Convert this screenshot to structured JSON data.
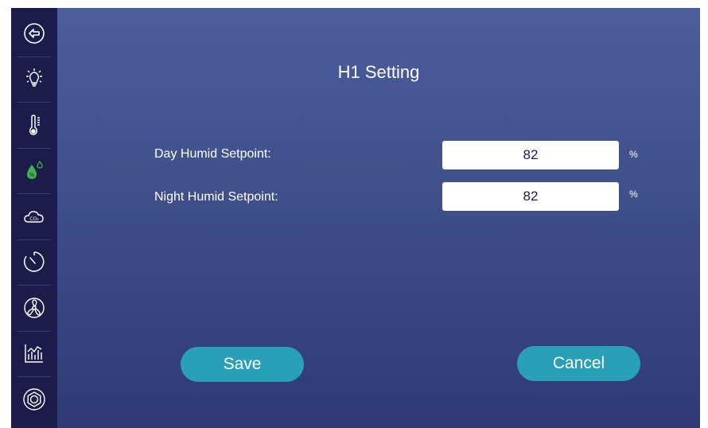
{
  "sidebar": {
    "items": [
      {
        "icon": "back-arrow-icon"
      },
      {
        "icon": "light-bulb-icon"
      },
      {
        "icon": "thermometer-icon"
      },
      {
        "icon": "humidity-drop-icon",
        "active": true,
        "active_color": "#3cb54a"
      },
      {
        "icon": "co2-cloud-icon",
        "label": "CO₂"
      },
      {
        "icon": "timer-icon"
      },
      {
        "icon": "fan-icon"
      },
      {
        "icon": "chart-icon"
      },
      {
        "icon": "settings-hexagon-icon"
      }
    ]
  },
  "page": {
    "title": "H1 Setting"
  },
  "settings": {
    "day_humid": {
      "label": "Day Humid Setpoint:",
      "value": "82",
      "unit": "%"
    },
    "night_humid": {
      "label": "Night Humid Setpoint:",
      "value": "82",
      "unit": "%"
    }
  },
  "actions": {
    "save_label": "Save",
    "cancel_label": "Cancel"
  },
  "colors": {
    "sidebar_bg": "#1b1c4a",
    "button": "#2aa0b8",
    "active_icon": "#3cb54a"
  }
}
